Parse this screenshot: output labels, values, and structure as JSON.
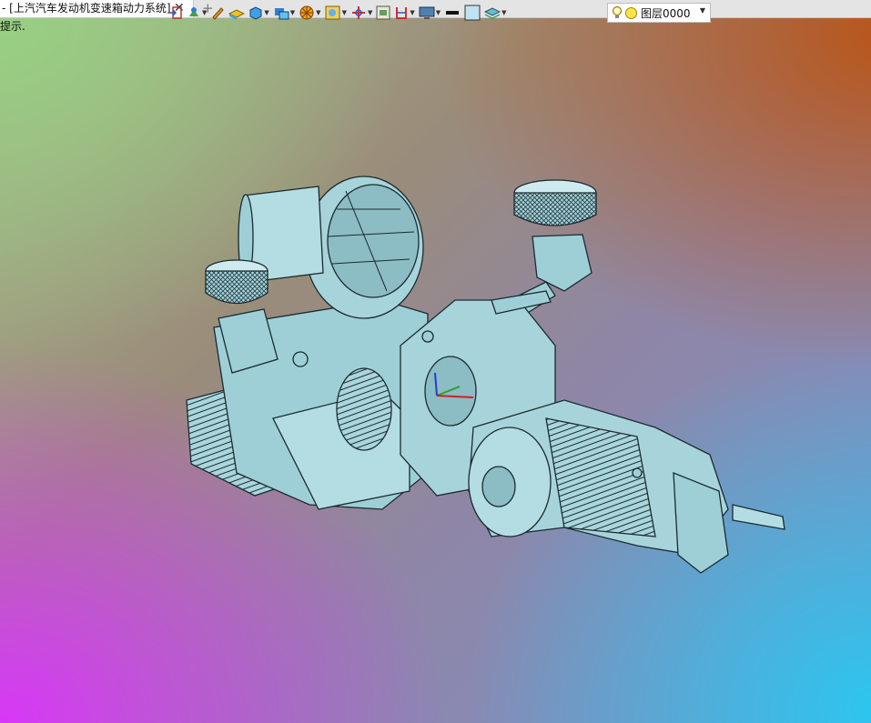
{
  "tab": {
    "title": "- [上汽汽车发动机变速箱动力系统]",
    "close_glyph": "✕",
    "add_glyph": "+"
  },
  "hint": "提示.",
  "toolbar": {
    "layer_name": "图层0000",
    "icons": [
      "exit-icon",
      "layers-icon",
      "pencil-icon",
      "sheet-icon",
      "cube-icon",
      "view-icon",
      "render-icon",
      "zoom-icon",
      "axis-icon",
      "frame-icon",
      "section-icon",
      "monitor-icon",
      "line-icon",
      "color-icon",
      "layer-stack-icon"
    ]
  },
  "colors": {
    "model": "#9ecfd6",
    "model_edge": "#1b2a30"
  }
}
